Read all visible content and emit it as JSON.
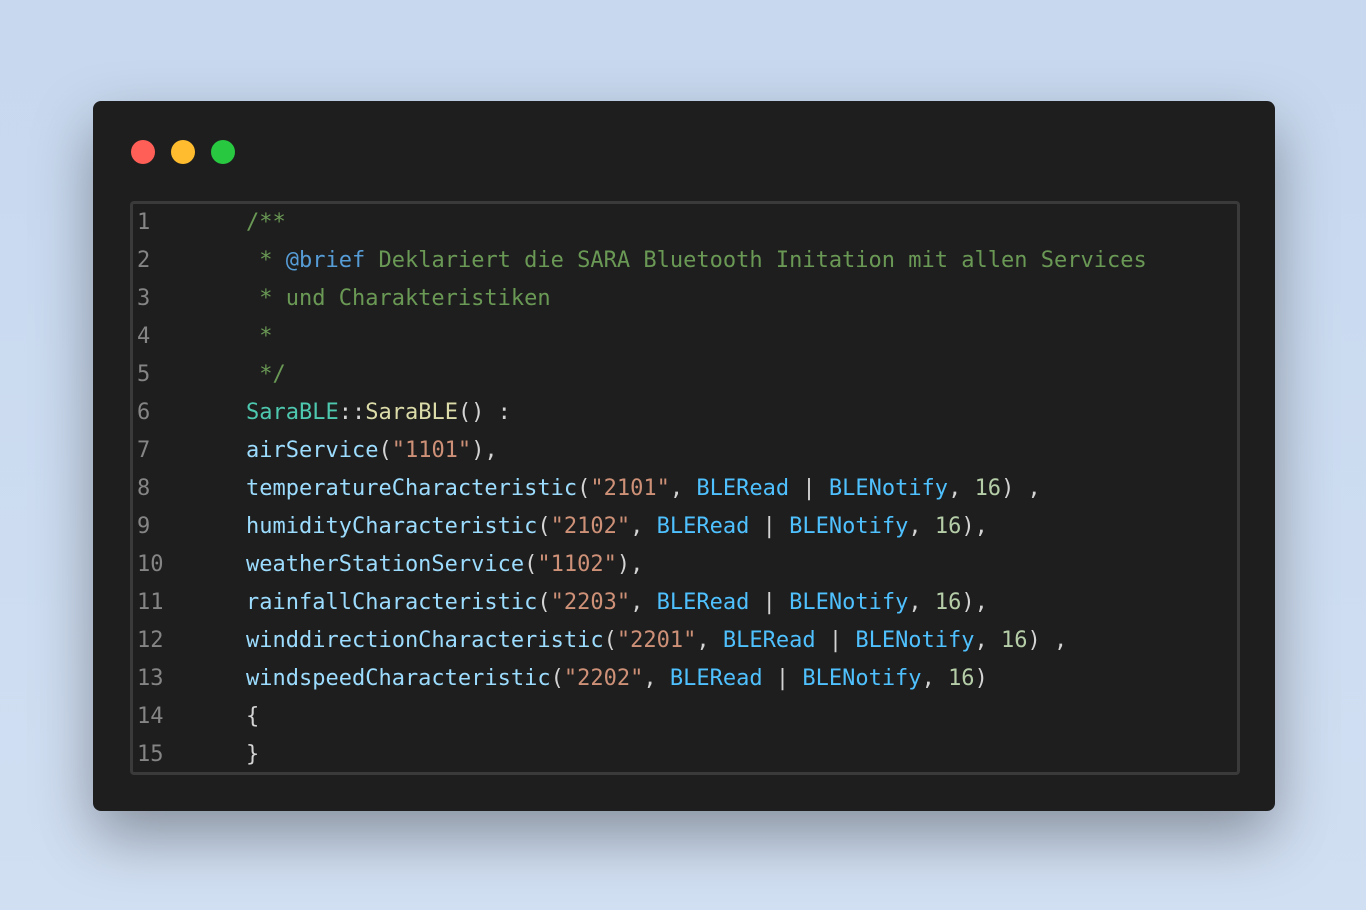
{
  "window": {
    "controls": [
      "close",
      "minimize",
      "maximize"
    ]
  },
  "lines": [
    {
      "n": "1",
      "tokens": [
        {
          "t": "/**",
          "k": "cmt"
        }
      ]
    },
    {
      "n": "2",
      "tokens": [
        {
          "t": " * ",
          "k": "cmt"
        },
        {
          "t": "@brief",
          "k": "doc"
        },
        {
          "t": " Deklariert die SARA Bluetooth Initation mit allen Services",
          "k": "cmt"
        }
      ]
    },
    {
      "n": "3",
      "tokens": [
        {
          "t": " * und Charakteristiken",
          "k": "cmt"
        }
      ]
    },
    {
      "n": "4",
      "tokens": [
        {
          "t": " *",
          "k": "cmt"
        }
      ]
    },
    {
      "n": "5",
      "tokens": [
        {
          "t": " */",
          "k": "cmt"
        }
      ]
    },
    {
      "n": "6",
      "tokens": [
        {
          "t": "SaraBLE",
          "k": "cls"
        },
        {
          "t": "::",
          "k": "plain"
        },
        {
          "t": "SaraBLE",
          "k": "fn"
        },
        {
          "t": "() :",
          "k": "plain"
        }
      ]
    },
    {
      "n": "7",
      "tokens": [
        {
          "t": "airService",
          "k": "mem"
        },
        {
          "t": "(",
          "k": "plain"
        },
        {
          "t": "\"1101\"",
          "k": "str"
        },
        {
          "t": "),",
          "k": "plain"
        }
      ]
    },
    {
      "n": "8",
      "tokens": [
        {
          "t": "temperatureCharacteristic",
          "k": "mem"
        },
        {
          "t": "(",
          "k": "plain"
        },
        {
          "t": "\"2101\"",
          "k": "str"
        },
        {
          "t": ", ",
          "k": "plain"
        },
        {
          "t": "BLERead",
          "k": "const"
        },
        {
          "t": " | ",
          "k": "plain"
        },
        {
          "t": "BLENotify",
          "k": "const"
        },
        {
          "t": ", ",
          "k": "plain"
        },
        {
          "t": "16",
          "k": "num"
        },
        {
          "t": ") ,",
          "k": "plain"
        }
      ]
    },
    {
      "n": "9",
      "tokens": [
        {
          "t": "humidityCharacteristic",
          "k": "mem"
        },
        {
          "t": "(",
          "k": "plain"
        },
        {
          "t": "\"2102\"",
          "k": "str"
        },
        {
          "t": ", ",
          "k": "plain"
        },
        {
          "t": "BLERead",
          "k": "const"
        },
        {
          "t": " | ",
          "k": "plain"
        },
        {
          "t": "BLENotify",
          "k": "const"
        },
        {
          "t": ", ",
          "k": "plain"
        },
        {
          "t": "16",
          "k": "num"
        },
        {
          "t": "),",
          "k": "plain"
        }
      ]
    },
    {
      "n": "10",
      "tokens": [
        {
          "t": "weatherStationService",
          "k": "mem"
        },
        {
          "t": "(",
          "k": "plain"
        },
        {
          "t": "\"1102\"",
          "k": "str"
        },
        {
          "t": "),",
          "k": "plain"
        }
      ]
    },
    {
      "n": "11",
      "tokens": [
        {
          "t": "rainfallCharacteristic",
          "k": "mem"
        },
        {
          "t": "(",
          "k": "plain"
        },
        {
          "t": "\"2203\"",
          "k": "str"
        },
        {
          "t": ", ",
          "k": "plain"
        },
        {
          "t": "BLERead",
          "k": "const"
        },
        {
          "t": " | ",
          "k": "plain"
        },
        {
          "t": "BLENotify",
          "k": "const"
        },
        {
          "t": ", ",
          "k": "plain"
        },
        {
          "t": "16",
          "k": "num"
        },
        {
          "t": "),",
          "k": "plain"
        }
      ]
    },
    {
      "n": "12",
      "tokens": [
        {
          "t": "winddirectionCharacteristic",
          "k": "mem"
        },
        {
          "t": "(",
          "k": "plain"
        },
        {
          "t": "\"2201\"",
          "k": "str"
        },
        {
          "t": ", ",
          "k": "plain"
        },
        {
          "t": "BLERead",
          "k": "const"
        },
        {
          "t": " | ",
          "k": "plain"
        },
        {
          "t": "BLENotify",
          "k": "const"
        },
        {
          "t": ", ",
          "k": "plain"
        },
        {
          "t": "16",
          "k": "num"
        },
        {
          "t": ") ,",
          "k": "plain"
        }
      ]
    },
    {
      "n": "13",
      "tokens": [
        {
          "t": "windspeedCharacteristic",
          "k": "mem"
        },
        {
          "t": "(",
          "k": "plain"
        },
        {
          "t": "\"2202\"",
          "k": "str"
        },
        {
          "t": ", ",
          "k": "plain"
        },
        {
          "t": "BLERead",
          "k": "const"
        },
        {
          "t": " | ",
          "k": "plain"
        },
        {
          "t": "BLENotify",
          "k": "const"
        },
        {
          "t": ", ",
          "k": "plain"
        },
        {
          "t": "16",
          "k": "num"
        },
        {
          "t": ")",
          "k": "plain"
        }
      ]
    },
    {
      "n": "14",
      "tokens": [
        {
          "t": "{",
          "k": "plain"
        }
      ]
    },
    {
      "n": "15",
      "tokens": [
        {
          "t": "}",
          "k": "plain"
        }
      ]
    }
  ]
}
